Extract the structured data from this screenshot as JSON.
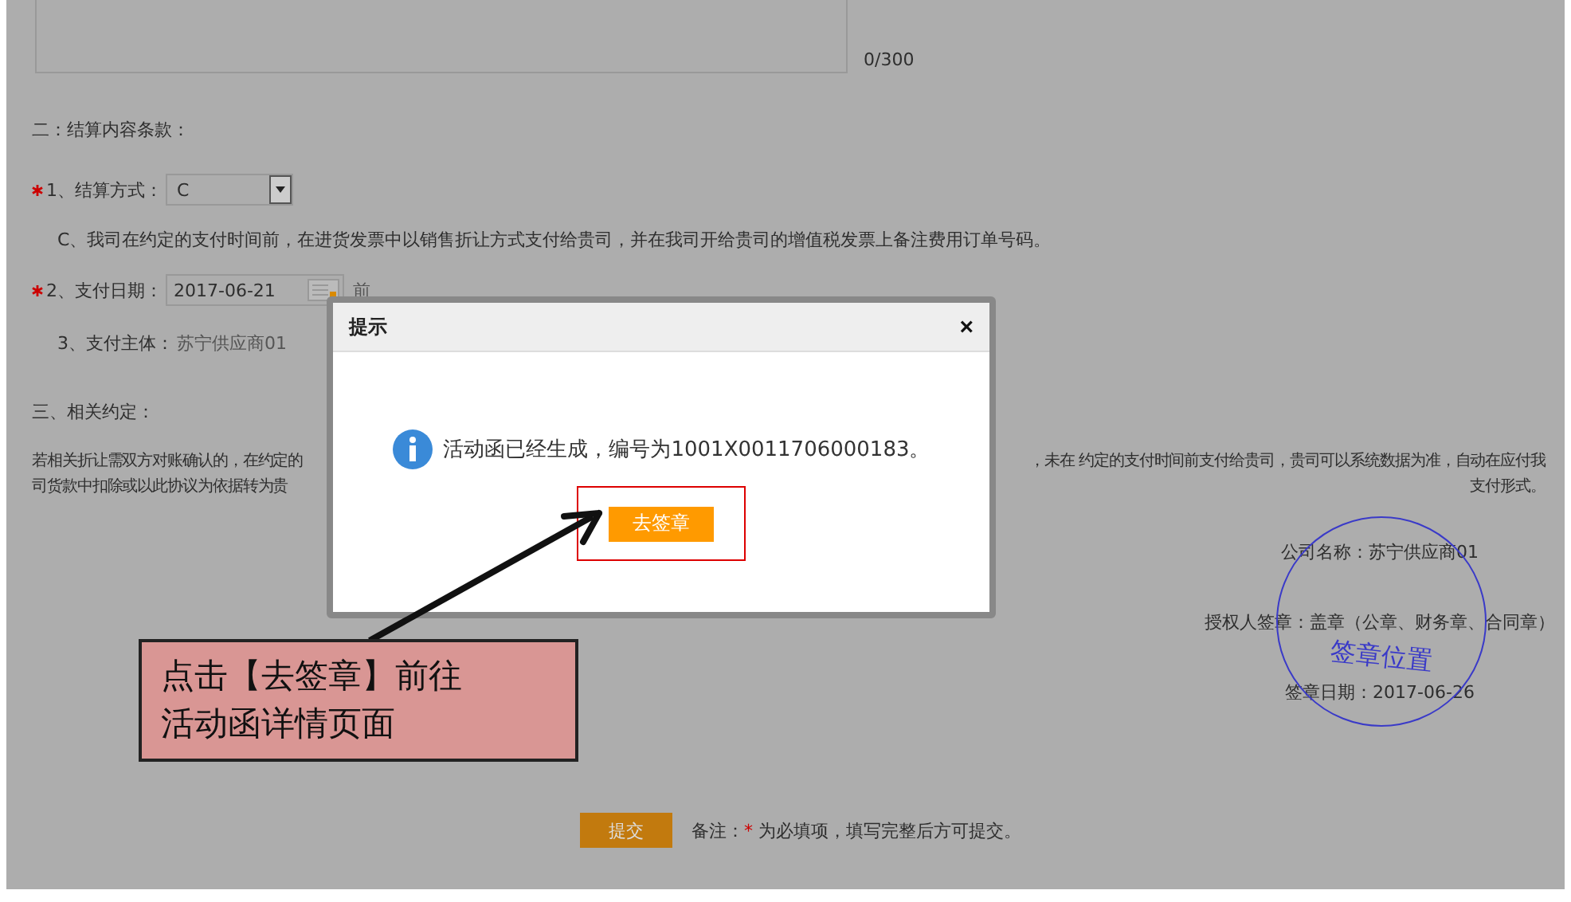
{
  "form": {
    "char_count": "0/300",
    "section_2_title": "二：结算内容条款：",
    "settlement": {
      "required": true,
      "label": "1、结算方式：",
      "value": "C"
    },
    "settlement_note": "C、我司在约定的支付时间前，在进货发票中以销售折让方式支付给贵司，并在我司开给贵司的增值税发票上备注费用订单号码。",
    "payment_date": {
      "required": true,
      "label": "2、支付日期：",
      "value": "2017-06-21",
      "suffix": "前"
    },
    "payment_party": {
      "label": "3、支付主体：",
      "value": "苏宁供应商01"
    },
    "section_3_title": "三、相关约定：",
    "terms_lines": [
      {
        "left": "若相关折让需双方对账确认的，在约定的",
        "right": "，未在 约定的支付时间前支付给贵司，贵司可以系统数据为准，自动在应付我"
      },
      {
        "left": "司货款中扣除或以此协议为依据转为贵",
        "right": "支付形式。"
      }
    ],
    "signature": {
      "company": "公司名称：苏宁供应商01",
      "authorized": "授权人签章：盖章（公章、财务章、合同章）",
      "date": "签章日期：2017-06-26",
      "stamp": "签章位置"
    },
    "submit": {
      "label": "提交"
    },
    "note": {
      "label": "备注：",
      "required_mark": "*",
      "text": "为必填项，填写完整后方可提交。"
    }
  },
  "dialog": {
    "title": "提示",
    "close": "×",
    "message": "活动函已经生成，编号为1001X0011706000183。",
    "button": "去签章"
  },
  "callout": {
    "text_lines": [
      "点击【去签章】前往",
      "活动函详情页面"
    ]
  }
}
